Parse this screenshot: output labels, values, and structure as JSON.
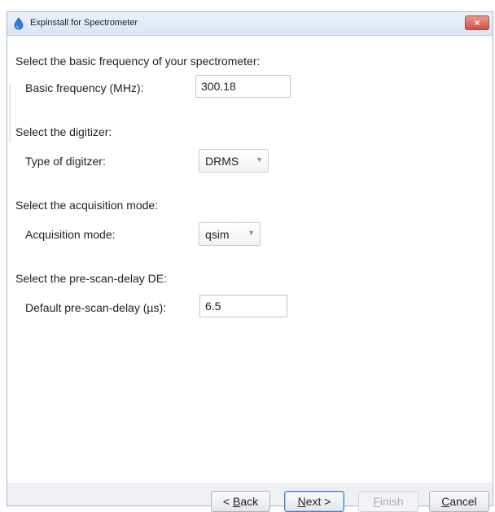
{
  "window": {
    "title": "Expinstall for Spectrometer",
    "close_symbol": "×"
  },
  "sections": {
    "frequency": {
      "heading": "Select the basic frequency of your spectrometer:",
      "label": "Basic frequency (MHz):",
      "value": "300.18"
    },
    "digitizer": {
      "heading": "Select the digitizer:",
      "label": "Type of digitzer:",
      "selected": "DRMS"
    },
    "acquisition": {
      "heading": "Select the acquisition mode:",
      "label": "Acquisition mode:",
      "selected": "qsim"
    },
    "prescan": {
      "heading": "Select the pre-scan-delay DE:",
      "label": "Default pre-scan-delay (µs):",
      "value": "6.5"
    }
  },
  "buttons": {
    "back": {
      "pre": "< ",
      "mnemonic": "B",
      "rest": "ack"
    },
    "next": {
      "mnemonic": "N",
      "rest": "ext >"
    },
    "finish": {
      "mnemonic": "F",
      "rest": "inish",
      "enabled": false
    },
    "cancel": {
      "mnemonic": "C",
      "rest": "ancel"
    }
  },
  "colors": {
    "accent": "#4a7fc0",
    "close_button": "#d0503f",
    "disabled_text": "#a8acb2"
  },
  "icons": {
    "app": "spectrometer-drop-icon",
    "close": "close-icon",
    "dropdown": "chevron-down-icon"
  }
}
